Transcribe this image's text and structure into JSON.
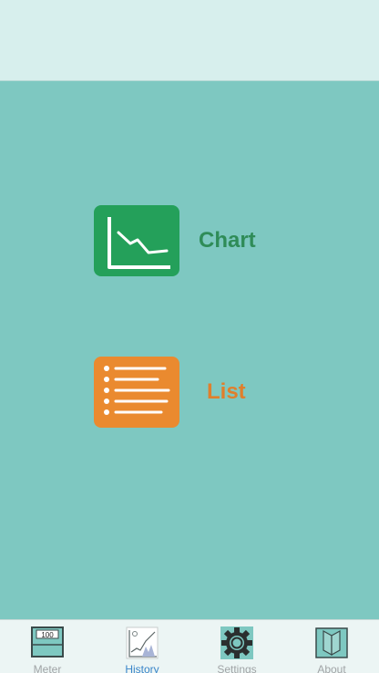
{
  "menu": {
    "chart": {
      "label": "Chart",
      "icon": "line-chart-icon",
      "color": "#24a05a",
      "text_color": "#2f8c58"
    },
    "list": {
      "label": "List",
      "icon": "list-icon",
      "color": "#ea8a2f",
      "text_color": "#e07f2c"
    }
  },
  "meter_icon_value": "100",
  "tabs": [
    {
      "label": "Meter",
      "icon": "meter-icon",
      "active": false
    },
    {
      "label": "History",
      "icon": "history-icon",
      "active": true
    },
    {
      "label": "Settings",
      "icon": "gear-icon",
      "active": false
    },
    {
      "label": "About",
      "icon": "book-icon",
      "active": false
    }
  ],
  "colors": {
    "header_bg": "#d7efed",
    "content_bg": "#7ec8c1",
    "tab_bar_bg": "#ecf5f4",
    "tab_active": "#3a86c9",
    "tab_inactive": "#a0a4a6"
  }
}
